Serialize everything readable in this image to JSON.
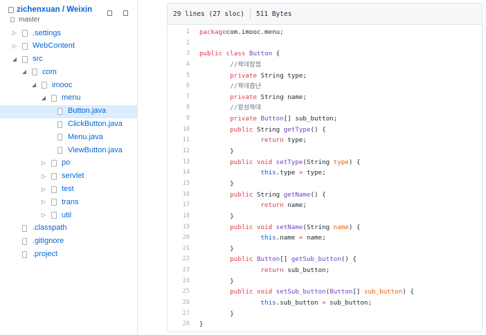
{
  "repo": {
    "owner": "zichenxuan",
    "separator": " / ",
    "name": "Weixin",
    "branch": "master"
  },
  "tree": [
    {
      "label": ".settings",
      "depth": 0,
      "type": "folder",
      "expanded": false,
      "selected": false
    },
    {
      "label": "WebContent",
      "depth": 0,
      "type": "folder",
      "expanded": false,
      "selected": false
    },
    {
      "label": "src",
      "depth": 0,
      "type": "folder",
      "expanded": true,
      "selected": false
    },
    {
      "label": "com",
      "depth": 1,
      "type": "folder",
      "expanded": true,
      "selected": false
    },
    {
      "label": "imooc",
      "depth": 2,
      "type": "folder",
      "expanded": true,
      "selected": false
    },
    {
      "label": "menu",
      "depth": 3,
      "type": "folder",
      "expanded": true,
      "selected": false
    },
    {
      "label": "Button.java",
      "depth": 4,
      "type": "file",
      "selected": true
    },
    {
      "label": "ClickButton.java",
      "depth": 4,
      "type": "file",
      "selected": false
    },
    {
      "label": "Menu.java",
      "depth": 4,
      "type": "file",
      "selected": false
    },
    {
      "label": "ViewButton.java",
      "depth": 4,
      "type": "file",
      "selected": false
    },
    {
      "label": "po",
      "depth": 3,
      "type": "folder",
      "expanded": false,
      "selected": false
    },
    {
      "label": "servlet",
      "depth": 3,
      "type": "folder",
      "expanded": false,
      "selected": false
    },
    {
      "label": "test",
      "depth": 3,
      "type": "folder",
      "expanded": false,
      "selected": false
    },
    {
      "label": "trans",
      "depth": 3,
      "type": "folder",
      "expanded": false,
      "selected": false
    },
    {
      "label": "util",
      "depth": 3,
      "type": "folder",
      "expanded": false,
      "selected": false
    },
    {
      "label": ".classpath",
      "depth": 0,
      "type": "file",
      "selected": false
    },
    {
      "label": ".gitignore",
      "depth": 0,
      "type": "file",
      "selected": false
    },
    {
      "label": ".project",
      "depth": 0,
      "type": "file",
      "selected": false
    }
  ],
  "file_info": {
    "lines": "29 lines (27 sloc)",
    "size": "511 Bytes"
  },
  "code_lines": [
    {
      "n": "1",
      "t": [
        [
          "kw",
          "package"
        ],
        [
          "",
          "com.imooc.menu;"
        ]
      ]
    },
    {
      "n": "2",
      "t": []
    },
    {
      "n": "3",
      "t": [
        [
          "kw",
          "public class"
        ],
        [
          "",
          " "
        ],
        [
          "ty",
          "Button"
        ],
        [
          "",
          " {"
        ]
      ]
    },
    {
      "n": "4",
      "t": [
        [
          "",
          "        "
        ],
        [
          "cm",
          "//꽉데잠썹"
        ]
      ]
    },
    {
      "n": "5",
      "t": [
        [
          "",
          "        "
        ],
        [
          "kw",
          "private"
        ],
        [
          "",
          " String type;"
        ]
      ]
    },
    {
      "n": "6",
      "t": [
        [
          "",
          "        "
        ],
        [
          "cm",
          "//꽉데츰냔"
        ]
      ]
    },
    {
      "n": "7",
      "t": [
        [
          "",
          "        "
        ],
        [
          "kw",
          "private"
        ],
        [
          "",
          " String name;"
        ]
      ]
    },
    {
      "n": "8",
      "t": [
        [
          "",
          "        "
        ],
        [
          "cm",
          "//왕섬꽉데"
        ]
      ]
    },
    {
      "n": "9",
      "t": [
        [
          "",
          "        "
        ],
        [
          "kw",
          "private"
        ],
        [
          "",
          " "
        ],
        [
          "ty",
          "Button"
        ],
        [
          "",
          "[] sub_button;"
        ]
      ]
    },
    {
      "n": "10",
      "t": [
        [
          "",
          "        "
        ],
        [
          "kw",
          "public"
        ],
        [
          "",
          " String "
        ],
        [
          "fn",
          "getType"
        ],
        [
          "",
          "() {"
        ]
      ]
    },
    {
      "n": "11",
      "t": [
        [
          "",
          "                "
        ],
        [
          "kw",
          "return"
        ],
        [
          "",
          " type;"
        ]
      ]
    },
    {
      "n": "12",
      "t": [
        [
          "",
          "        }"
        ]
      ]
    },
    {
      "n": "13",
      "t": [
        [
          "",
          "        "
        ],
        [
          "kw",
          "public void"
        ],
        [
          "",
          " "
        ],
        [
          "fn",
          "setType"
        ],
        [
          "",
          "(String "
        ],
        [
          "pm",
          "type"
        ],
        [
          "",
          ") {"
        ]
      ]
    },
    {
      "n": "14",
      "t": [
        [
          "",
          "                "
        ],
        [
          "th",
          "this"
        ],
        [
          "",
          ".type "
        ],
        [
          "kw",
          "="
        ],
        [
          "",
          " type;"
        ]
      ]
    },
    {
      "n": "15",
      "t": [
        [
          "",
          "        }"
        ]
      ]
    },
    {
      "n": "16",
      "t": [
        [
          "",
          "        "
        ],
        [
          "kw",
          "public"
        ],
        [
          "",
          " String "
        ],
        [
          "fn",
          "getName"
        ],
        [
          "",
          "() {"
        ]
      ]
    },
    {
      "n": "17",
      "t": [
        [
          "",
          "                "
        ],
        [
          "kw",
          "return"
        ],
        [
          "",
          " name;"
        ]
      ]
    },
    {
      "n": "18",
      "t": [
        [
          "",
          "        }"
        ]
      ]
    },
    {
      "n": "19",
      "t": [
        [
          "",
          "        "
        ],
        [
          "kw",
          "public void"
        ],
        [
          "",
          " "
        ],
        [
          "fn",
          "setName"
        ],
        [
          "",
          "(String "
        ],
        [
          "pm",
          "name"
        ],
        [
          "",
          ") {"
        ]
      ]
    },
    {
      "n": "20",
      "t": [
        [
          "",
          "                "
        ],
        [
          "th",
          "this"
        ],
        [
          "",
          ".name "
        ],
        [
          "kw",
          "="
        ],
        [
          "",
          " name;"
        ]
      ]
    },
    {
      "n": "21",
      "t": [
        [
          "",
          "        }"
        ]
      ]
    },
    {
      "n": "22",
      "t": [
        [
          "",
          "        "
        ],
        [
          "kw",
          "public"
        ],
        [
          "",
          " "
        ],
        [
          "ty",
          "Button"
        ],
        [
          "",
          "[] "
        ],
        [
          "fn",
          "getSub_button"
        ],
        [
          "",
          "() {"
        ]
      ]
    },
    {
      "n": "23",
      "t": [
        [
          "",
          "                "
        ],
        [
          "kw",
          "return"
        ],
        [
          "",
          " sub_button;"
        ]
      ]
    },
    {
      "n": "24",
      "t": [
        [
          "",
          "        }"
        ]
      ]
    },
    {
      "n": "25",
      "t": [
        [
          "",
          "        "
        ],
        [
          "kw",
          "public void"
        ],
        [
          "",
          " "
        ],
        [
          "fn",
          "setSub_button"
        ],
        [
          "",
          "("
        ],
        [
          "ty",
          "Button"
        ],
        [
          "",
          "[] "
        ],
        [
          "pm",
          "sub_button"
        ],
        [
          "",
          ") {"
        ]
      ]
    },
    {
      "n": "26",
      "t": [
        [
          "",
          "                "
        ],
        [
          "th",
          "this"
        ],
        [
          "",
          ".sub_button "
        ],
        [
          "kw",
          "="
        ],
        [
          "",
          " sub_button;"
        ]
      ]
    },
    {
      "n": "27",
      "t": [
        [
          "",
          "        }"
        ]
      ]
    },
    {
      "n": "28",
      "t": [
        [
          "",
          "}"
        ]
      ]
    }
  ],
  "icons": {
    "repo": "repo-icon",
    "branch": "branch-icon",
    "folder": "folder-icon",
    "file": "file-icon",
    "collapsed": "caret-right-icon",
    "expanded": "caret-down-icon"
  },
  "colors": {
    "link": "#0366d6",
    "selected_row": "#dbedff",
    "keyword": "#d73a49",
    "type": "#6f42c1",
    "param": "#e36209",
    "comment": "#6a737d",
    "this": "#005cc5"
  }
}
